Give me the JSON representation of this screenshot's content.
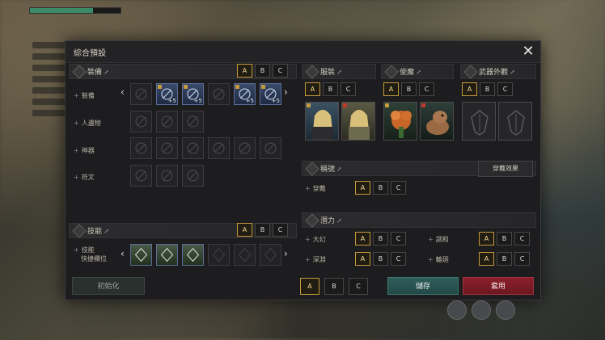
{
  "dialog": {
    "title": "綜合預設",
    "close_icon": "close-icon"
  },
  "equipment": {
    "header": "裝備",
    "ext_glyph": "↗",
    "presets": [
      "A",
      "B",
      "C"
    ],
    "active_preset": "A",
    "rows": [
      {
        "label": "裝備",
        "slots": [
          {
            "icon": "bow-icon",
            "equipped": false,
            "level": ""
          },
          {
            "icon": "helmet-icon",
            "equipped": true,
            "level": "+5"
          },
          {
            "icon": "chestplate-icon",
            "equipped": true,
            "level": "+5"
          },
          {
            "icon": "gloves-icon",
            "equipped": false,
            "level": ""
          },
          {
            "icon": "pants-icon",
            "equipped": true,
            "level": "+5"
          },
          {
            "icon": "boots-icon",
            "equipped": true,
            "level": "+5"
          }
        ]
      },
      {
        "label": "人遺物",
        "slots": [
          {
            "icon": "feather-icon"
          },
          {
            "icon": "compass-icon"
          },
          {
            "icon": "spiral-icon"
          }
        ]
      },
      {
        "label": "神器",
        "slots": [
          {
            "icon": "lotus-icon"
          },
          {
            "icon": "tree-icon"
          },
          {
            "icon": "sword-icon"
          },
          {
            "icon": "bell-icon"
          },
          {
            "icon": "book-icon"
          },
          {
            "icon": "urn-icon"
          }
        ]
      },
      {
        "label": "符文",
        "slots": [
          {
            "icon": "leo-icon"
          },
          {
            "icon": "taurus-icon"
          },
          {
            "icon": "aries-icon"
          }
        ]
      }
    ]
  },
  "skills": {
    "header": "技能",
    "ext_glyph": "↗",
    "presets": [
      "A",
      "B",
      "C"
    ],
    "active_preset": "A",
    "row_label_line1": "技能",
    "row_label_line2": "快捷欄位"
  },
  "appearance": {
    "header": "服裝",
    "ext_glyph": "↗",
    "presets": [
      "A",
      "B",
      "C"
    ],
    "active_preset": "A"
  },
  "servant": {
    "header": "使魔",
    "ext_glyph": "↗",
    "presets": [
      "A",
      "B",
      "C"
    ],
    "active_preset": "A"
  },
  "weapon_appearance": {
    "header": "武器外觀",
    "ext_glyph": "↗",
    "presets": [
      "A",
      "B",
      "C"
    ],
    "active_preset": "A"
  },
  "title_section": {
    "header": "稱號",
    "ext_glyph": "↗",
    "effect_button": "穿戴效果",
    "row_label": "穿戴",
    "presets": [
      "A",
      "B",
      "C"
    ],
    "active_preset": "A"
  },
  "stats": {
    "header": "潛力",
    "ext_glyph": "↗",
    "rows": [
      {
        "label": "大幻",
        "presets": [
          "A",
          "B",
          "C"
        ],
        "active": "A"
      },
      {
        "label": "調和",
        "presets": [
          "A",
          "B",
          "C"
        ],
        "active": "A"
      },
      {
        "label": "深淵",
        "presets": [
          "A",
          "B",
          "C"
        ],
        "active": "A"
      },
      {
        "label": "輪廻",
        "presets": [
          "A",
          "B",
          "C"
        ],
        "active": "A"
      }
    ]
  },
  "footer": {
    "init_label": "初始化",
    "presets": [
      "A",
      "B",
      "C"
    ],
    "active_preset": "A",
    "save_label": "儲存",
    "apply_label": "套用"
  },
  "colors": {
    "accent_gold": "#c49a3c",
    "save_teal": "#2f5e58",
    "apply_red": "#8a1f2a"
  }
}
